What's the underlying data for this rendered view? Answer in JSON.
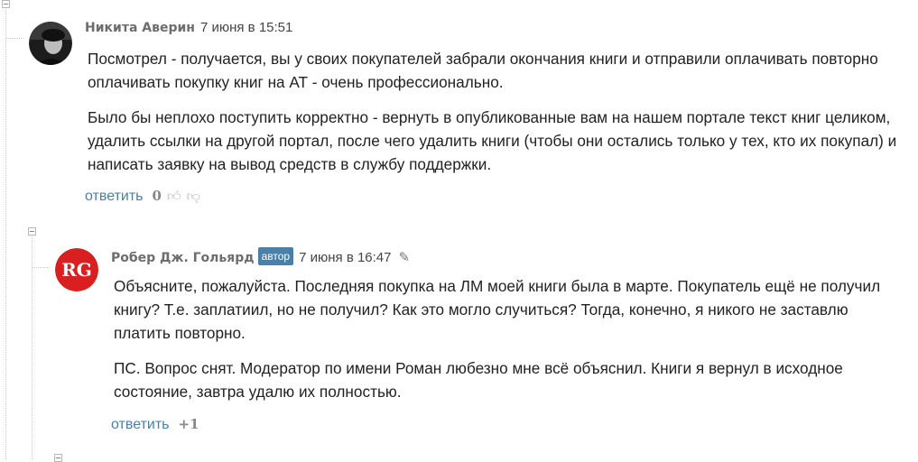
{
  "comments": [
    {
      "author": "Никита Аверин",
      "date": "7 июня в 15:51",
      "paragraphs": [
        "Посмотрел - получается, вы у своих покупателей забрали окончания книги и отправили оплачивать повторно оплачивать покупку книг на АТ - очень профессионально.",
        "Было бы неплохо поступить корректно - вернуть в опубликованные вам на нашем портале текст книг целиком, удалить ссылки на другой портал, после чего удалить книги (чтобы они остались только у тех, кто их покупал) и написать заявку на вывод средств в службу поддержки."
      ],
      "reply_label": "ответить",
      "score": "0"
    },
    {
      "author": "Робер Дж. Гольярд",
      "badge": "автор",
      "date": "7 июня в 16:47",
      "paragraphs": [
        "Объясните, пожалуйста. Последняя покупка на ЛМ моей книги была в марте. Покупатель ещё не получил книгу? Т.е. заплатиил, но не получил? Как это могло случиться? Тогда, конечно, я никого не заставлю платить повторно.",
        "ПС. Вопрос снят. Модератор по имени Роман любезно мне всё объяснил. Книги я вернул в исходное состояние, завтра удалю их полностью."
      ],
      "reply_label": "ответить",
      "score": "+1"
    }
  ],
  "avatar2_monogram": "RG",
  "colors": {
    "link": "#4a7fa8",
    "badge": "#4a7fa8",
    "avatar2_bg": "#d91f1f"
  }
}
